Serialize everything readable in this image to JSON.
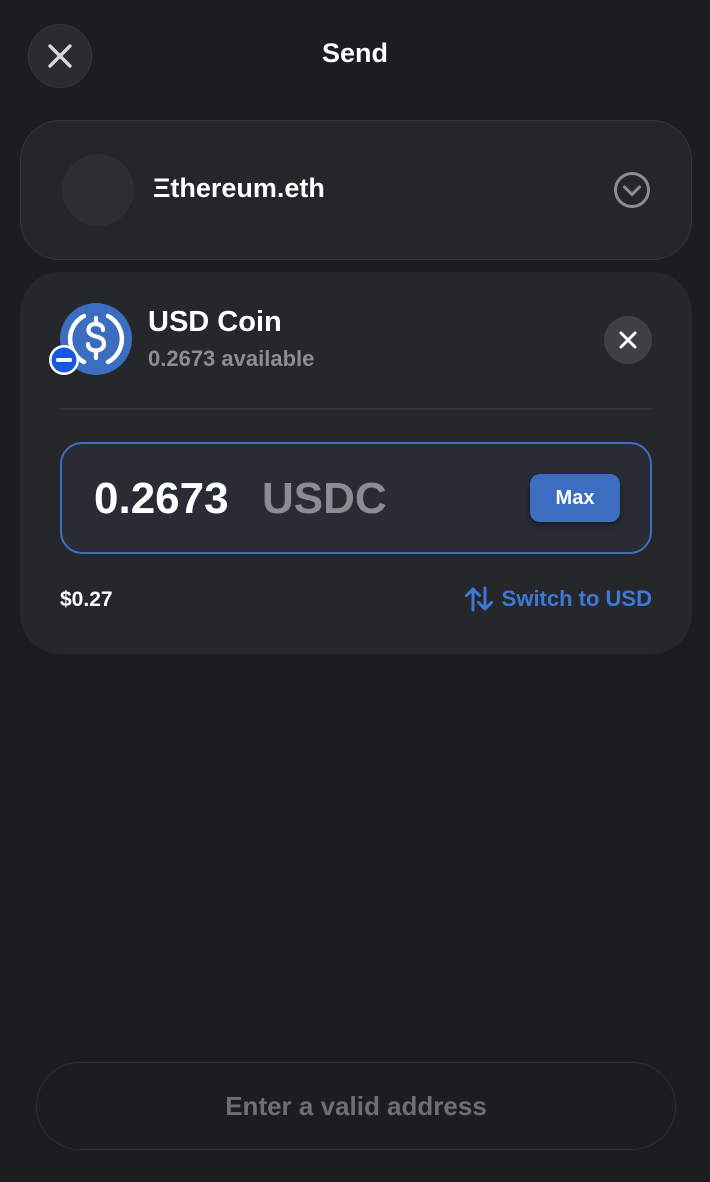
{
  "header": {
    "title": "Send",
    "close_icon": "close-icon"
  },
  "account": {
    "name": "Ξthereum.eth",
    "chevron_icon": "chevron-down-circle-icon"
  },
  "token": {
    "name": "USD Coin",
    "available": "0.2673 available",
    "icon": "usdc-coin-icon",
    "badge_icon": "network-badge-icon",
    "remove_icon": "close-icon"
  },
  "amount": {
    "value": "0.2673",
    "unit": "USDC",
    "max_label": "Max"
  },
  "fiat": {
    "value": "$0.27",
    "switch_label": "Switch to USD",
    "switch_icon": "swap-arrows-icon"
  },
  "footer": {
    "button_label": "Enter a valid address"
  },
  "colors": {
    "background": "#1c1d20",
    "accent": "#3c78d8",
    "max_button": "#3b6dc0",
    "muted_text": "#8c8d92"
  }
}
